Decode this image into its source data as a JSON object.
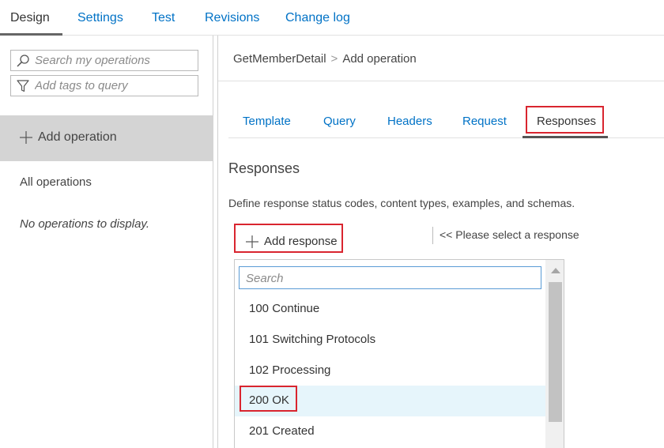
{
  "top_tabs": [
    {
      "label": "Design",
      "active": true
    },
    {
      "label": "Settings",
      "active": false
    },
    {
      "label": "Test",
      "active": false
    },
    {
      "label": "Revisions",
      "active": false
    },
    {
      "label": "Change log",
      "active": false
    }
  ],
  "left_panel": {
    "search_placeholder": "Search my operations",
    "tags_placeholder": "Add tags to query",
    "add_operation_label": "Add operation",
    "all_operations_label": "All operations",
    "empty_message": "No operations to display."
  },
  "breadcrumb": {
    "api": "GetMemberDetail",
    "separator": ">",
    "current": "Add operation"
  },
  "sub_tabs": [
    {
      "label": "Template",
      "active": false
    },
    {
      "label": "Query",
      "active": false
    },
    {
      "label": "Headers",
      "active": false
    },
    {
      "label": "Request",
      "active": false
    },
    {
      "label": "Responses",
      "active": true
    }
  ],
  "responses": {
    "title": "Responses",
    "description": "Define response status codes, content types, examples, and schemas.",
    "add_response_label": "Add response",
    "select_hint": "<< Please select a response"
  },
  "dropdown": {
    "search_placeholder": "Search",
    "items": [
      {
        "label": "100 Continue"
      },
      {
        "label": "101 Switching Protocols"
      },
      {
        "label": "102 Processing"
      },
      {
        "label": "200 OK"
      },
      {
        "label": "201 Created"
      }
    ]
  },
  "colors": {
    "accent": "#0072c6",
    "highlight": "#d9252f",
    "hover_row": "#e6f5fb",
    "selected_panel": "#d4d4d4"
  }
}
